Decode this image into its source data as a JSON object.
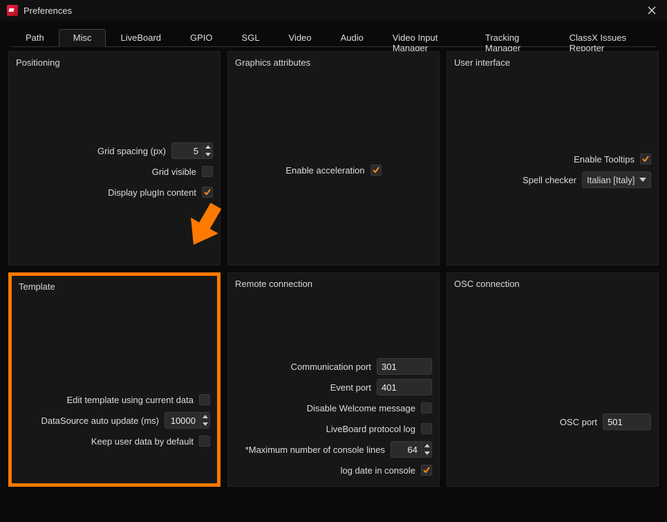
{
  "window": {
    "title": "Preferences"
  },
  "tabs": [
    "Path",
    "Misc",
    "LiveBoard",
    "GPIO",
    "SGL",
    "Video",
    "Audio",
    "Video Input Manager",
    "Tracking Manager",
    "ClassX Issues Reporter"
  ],
  "active_tab": 1,
  "panels": {
    "positioning": {
      "title": "Positioning",
      "grid_spacing_label": "Grid spacing (px)",
      "grid_spacing_value": "5",
      "grid_visible_label": "Grid visible",
      "grid_visible_checked": false,
      "display_plugin_label": "Display plugIn content",
      "display_plugin_checked": true
    },
    "graphics": {
      "title": "Graphics attributes",
      "enable_accel_label": "Enable acceleration",
      "enable_accel_checked": true
    },
    "ui": {
      "title": "User interface",
      "enable_tooltips_label": "Enable Tooltips",
      "enable_tooltips_checked": true,
      "spell_label": "Spell checker",
      "spell_value": "Italian [Italy]"
    },
    "template": {
      "title": "Template",
      "edit_label": "Edit template using current data",
      "edit_checked": false,
      "auto_label": "DataSource auto update (ms)",
      "auto_value": "10000",
      "keep_label": "Keep user data by default",
      "keep_checked": false
    },
    "remote": {
      "title": "Remote connection",
      "comm_label": "Communication port",
      "comm_value": "301",
      "event_label": "Event port",
      "event_value": "401",
      "welcome_label": "Disable Welcome message",
      "welcome_checked": false,
      "protolog_label": "LiveBoard protocol log",
      "protolog_checked": false,
      "maxlines_label": "*Maximum number of console lines",
      "maxlines_value": "64",
      "logdate_label": "log date in console",
      "logdate_checked": true
    },
    "osc": {
      "title": "OSC connection",
      "port_label": "OSC port",
      "port_value": "501"
    }
  }
}
